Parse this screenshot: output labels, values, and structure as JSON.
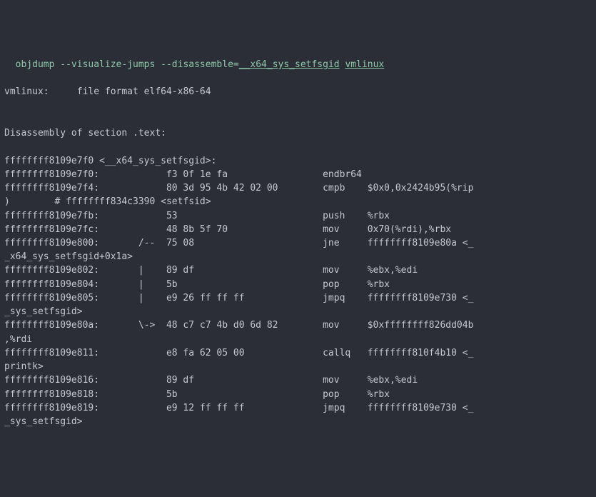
{
  "command": {
    "parts": [
      {
        "t": "objdump --visualize-jumps --disassemble=",
        "u": false
      },
      {
        "t": "__x64_sys_setfsgid",
        "u": true
      },
      {
        "t": " ",
        "u": false
      },
      {
        "t": "vmlinux",
        "u": true
      }
    ]
  },
  "file_line": "vmlinux:     file format elf64-x86-64",
  "section_line": "Disassembly of section .text:",
  "symbol_header": "ffffffff8109e7f0 <__x64_sys_setfsgid>:",
  "rows": [
    {
      "addr": "ffffffff8109e7f0:",
      "hex": "",
      "jump": "",
      "bytes": "f3 0f 1e fa",
      "mn": "endbr64",
      "op": "",
      "wrap": ""
    },
    {
      "addr": "ffffffff8109e7f4:",
      "hex": "",
      "jump": "",
      "bytes": "80 3d 95 4b 42 02 00",
      "mn": "cmpb",
      "op": "$0x0,0x2424b95(%rip",
      "wrap": ")        # ffffffff834c3390 <setfsid>"
    },
    {
      "addr": "ffffffff8109e7fb:",
      "hex": "",
      "jump": "",
      "bytes": "53",
      "mn": "push",
      "op": "%rbx",
      "wrap": ""
    },
    {
      "addr": "ffffffff8109e7fc:",
      "hex": "",
      "jump": "",
      "bytes": "48 8b 5f 70",
      "mn": "mov",
      "op": "0x70(%rdi),%rbx",
      "wrap": ""
    },
    {
      "addr": "ffffffff8109e800:",
      "hex": "",
      "jump": "/-- ",
      "bytes": "75 08",
      "mn": "jne",
      "op": "ffffffff8109e80a <_",
      "wrap": "_x64_sys_setfsgid+0x1a>"
    },
    {
      "addr": "ffffffff8109e802:",
      "hex": "",
      "jump": "|   ",
      "bytes": "89 df",
      "mn": "mov",
      "op": "%ebx,%edi",
      "wrap": ""
    },
    {
      "addr": "ffffffff8109e804:",
      "hex": "",
      "jump": "|   ",
      "bytes": "5b",
      "mn": "pop",
      "op": "%rbx",
      "wrap": ""
    },
    {
      "addr": "ffffffff8109e805:",
      "hex": "",
      "jump": "|   ",
      "bytes": "e9 26 ff ff ff",
      "mn": "jmpq",
      "op": "ffffffff8109e730 <_",
      "wrap": "_sys_setfsgid>"
    },
    {
      "addr": "ffffffff8109e80a:",
      "hex": "",
      "jump": "\\-> ",
      "bytes": "48 c7 c7 4b d0 6d 82",
      "mn": "mov",
      "op": "$0xffffffff826dd04b",
      "wrap": ",%rdi"
    },
    {
      "addr": "ffffffff8109e811:",
      "hex": "",
      "jump": "",
      "bytes": "e8 fa 62 05 00",
      "mn": "callq",
      "op": "ffffffff810f4b10 <_",
      "wrap": "printk>"
    },
    {
      "addr": "ffffffff8109e816:",
      "hex": "",
      "jump": "",
      "bytes": "89 df",
      "mn": "mov",
      "op": "%ebx,%edi",
      "wrap": ""
    },
    {
      "addr": "ffffffff8109e818:",
      "hex": "",
      "jump": "",
      "bytes": "5b",
      "mn": "pop",
      "op": "%rbx",
      "wrap": ""
    },
    {
      "addr": "ffffffff8109e819:",
      "hex": "",
      "jump": "",
      "bytes": "e9 12 ff ff ff",
      "mn": "jmpq",
      "op": "ffffffff8109e730 <_",
      "wrap": "_sys_setfsgid>"
    }
  ]
}
